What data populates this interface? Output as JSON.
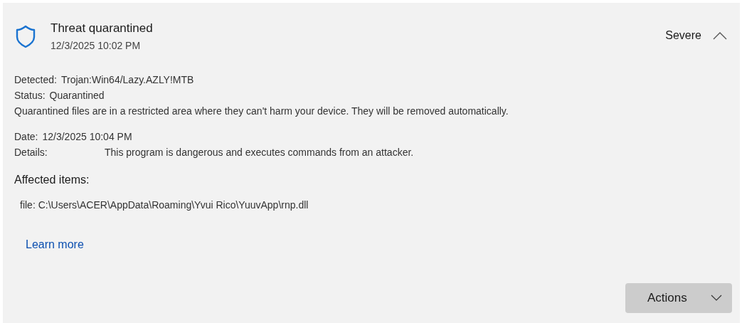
{
  "threat": {
    "title": "Threat quarantined",
    "time": "12/3/2025 10:02 PM",
    "severity": "Severe",
    "expanded": true
  },
  "facts": [
    {
      "label": "Detected:",
      "value": "Trojan:Win64/Lazy.AZLY!MTB"
    },
    {
      "label": "Status:",
      "value": "Quarantined"
    }
  ],
  "note": "Quarantined files are in a restricted area where they can't harm your device. They will be removed automatically.",
  "facts2": [
    {
      "label": "Date:",
      "value": "12/3/2025 10:04 PM",
      "kind": "inline"
    },
    {
      "label": "Details:",
      "value": "This program is dangerous and executes commands from an attacker.",
      "kind": "column"
    }
  ],
  "affected": {
    "heading": "Affected items:",
    "items": [
      "file: C:\\Users\\ACER\\AppData\\Roaming\\Yvui Rico\\YuuvApp\\rnp.dll"
    ]
  },
  "link": "Learn more",
  "actions_button": "Actions"
}
